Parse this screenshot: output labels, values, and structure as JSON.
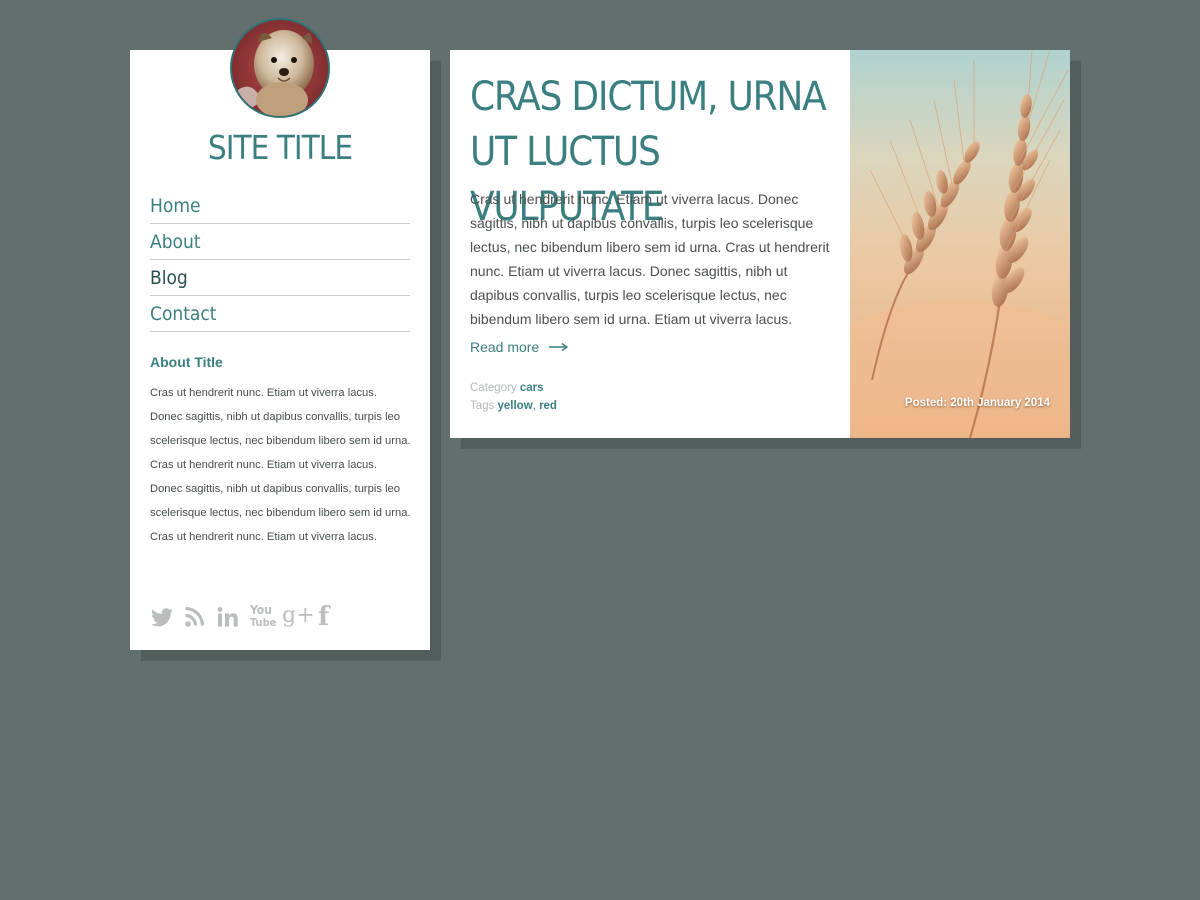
{
  "colors": {
    "background": "#636e6f",
    "card": "#ffffff",
    "accent": "#3b7f80",
    "nav_current": "#2a4e4f",
    "body_text": "#4a4f4f",
    "icon_grey": "#b9bdbd"
  },
  "sidebar": {
    "avatar_icon": "dog-photo-avatar",
    "site_title": "SITE TITLE",
    "nav": [
      {
        "label": "Home"
      },
      {
        "label": "About"
      },
      {
        "label": "Blog",
        "current": true
      },
      {
        "label": "Contact"
      }
    ],
    "about": {
      "title": "About Title",
      "text": "Cras ut hendrerit nunc. Etiam ut viverra lacus. Donec sagittis, nibh ut dapibus convallis, turpis leo scelerisque lectus, nec bibendum libero sem id urna. Cras ut hendrerit nunc. Etiam ut viverra lacus. Donec sagittis, nibh ut dapibus convallis, turpis leo scelerisque lectus, nec bibendum libero sem id urna. Cras ut hendrerit nunc. Etiam ut viverra lacus."
    },
    "social": [
      {
        "icon": "twitter-icon"
      },
      {
        "icon": "rss-icon"
      },
      {
        "icon": "linkedin-icon"
      },
      {
        "icon": "youtube-icon",
        "text_top": "You",
        "text_bottom": "Tube"
      },
      {
        "icon": "google-plus-icon",
        "text": "g+"
      },
      {
        "icon": "facebook-icon",
        "text": "f"
      }
    ]
  },
  "post": {
    "title": "CRAS DICTUM, URNA UT LUCTUS VULPUTATE",
    "excerpt": "Cras ut hendrerit nunc. Etiam ut viverra lacus. Donec sagittis, nibh ut dapibus convallis, turpis leo scelerisque lectus, nec bibendum libero sem id urna. Cras ut hendrerit nunc. Etiam ut viverra lacus. Donec sagittis, nibh ut dapibus convallis, turpis leo scelerisque lectus, nec bibendum libero sem id urna. Etiam ut viverra lacus.",
    "read_more": "Read more",
    "read_more_icon": "arrow-right-icon",
    "category_label": "Category",
    "category": "cars",
    "tags_label": "Tags",
    "tags": [
      "yellow",
      "red"
    ],
    "tag_separator": ",",
    "image_icon": "wheat-photo",
    "posted": "Posted: 20th January 2014"
  }
}
